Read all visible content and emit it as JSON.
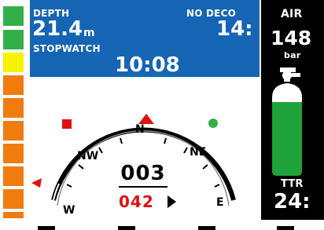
{
  "info": {
    "depth_label": "DEPTH",
    "depth_value": "21.4",
    "depth_unit": "m",
    "nodeco_label": "NO DECO",
    "nodeco_value": "14:",
    "stopwatch_label": "STOPWATCH",
    "stopwatch_value": "10:08"
  },
  "air": {
    "label": "AIR",
    "value": "148",
    "unit": "bar",
    "ttr_label": "TTR",
    "ttr_value": "24:"
  },
  "compass": {
    "heading": "003",
    "bearing": "042",
    "cardinals": {
      "n": "N",
      "ne": "NE",
      "nw": "NW",
      "e": "E",
      "w": "W"
    }
  },
  "ascent_rate": {
    "segments": [
      "green",
      "green",
      "yellow",
      "orange",
      "orange",
      "orange",
      "orange",
      "orange",
      "orange",
      "orange"
    ]
  },
  "colors": {
    "panel_blue": "#1565b4",
    "green": "#33b04a",
    "yellow": "#f7f200",
    "orange": "#f07c10",
    "red_marker": "#e01010",
    "tank_green": "#1fa33a"
  }
}
